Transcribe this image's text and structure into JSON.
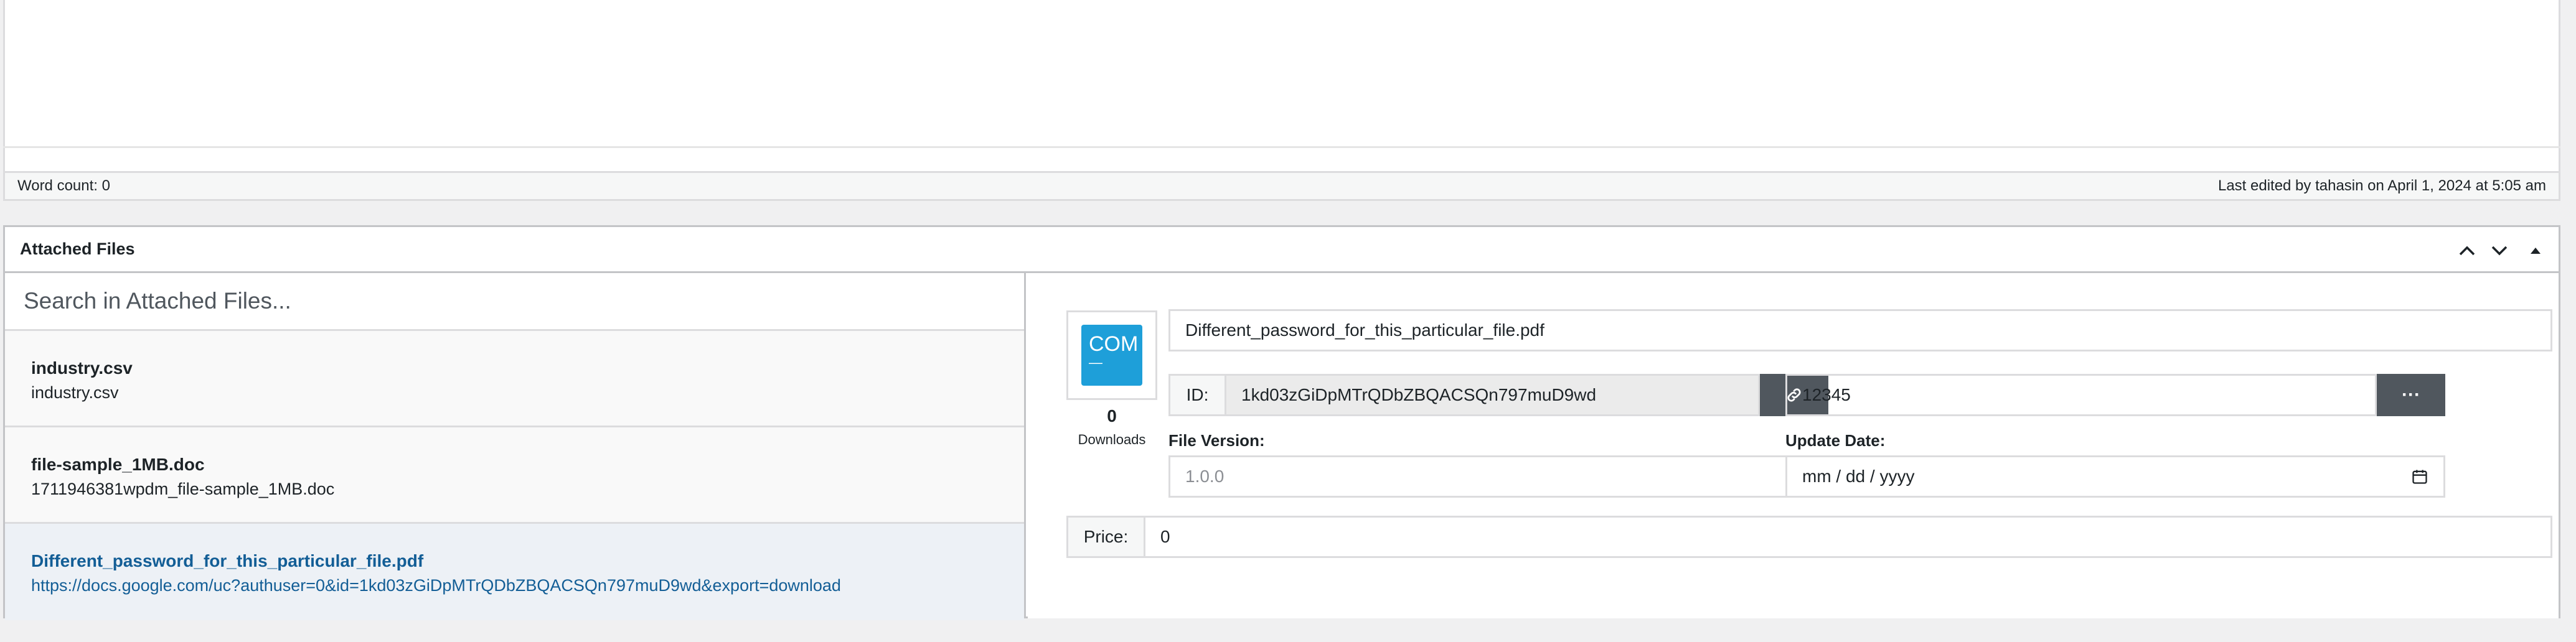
{
  "statusbar": {
    "word_count": "Word count: 0",
    "last_edited": "Last edited by tahasin on April 1, 2024 at 5:05 am"
  },
  "metabox": {
    "title": "Attached Files",
    "controls": [
      "chevron-up-icon",
      "chevron-down-icon",
      "triangle-up-icon"
    ]
  },
  "search": {
    "placeholder": "Search in Attached Files..."
  },
  "files": [
    {
      "title": "industry.csv",
      "subtitle": "industry.csv"
    },
    {
      "title": "file-sample_1MB.doc",
      "subtitle": "1711946381wpdm_file-sample_1MB.doc"
    },
    {
      "title": "Different_password_for_this_particular_file.pdf",
      "subtitle": "https://docs.google.com/uc?authuser=0&id=1kd03zGiDpMTrQDbZBQACSQn797muD9wd&export=download"
    }
  ],
  "details": {
    "icon_text": "COM",
    "icon_sub": "—",
    "downloads_count": "0",
    "downloads_label": "Downloads",
    "file_name": "Different_password_for_this_particular_file.pdf",
    "id_label": "ID:",
    "id_value": "1kd03zGiDpMTrQDbZBQACSQn797muD9wd",
    "password": "12345",
    "more_label": "···",
    "version_label": "File Version:",
    "version_placeholder": "1.0.0",
    "update_label": "Update Date:",
    "date_placeholder": "mm / dd / yyyy",
    "price_label": "Price:",
    "price_value": "0"
  },
  "colors": {
    "accent": "#135e96",
    "icon_bg": "#1e9fd9",
    "button_bg": "#50575e"
  }
}
